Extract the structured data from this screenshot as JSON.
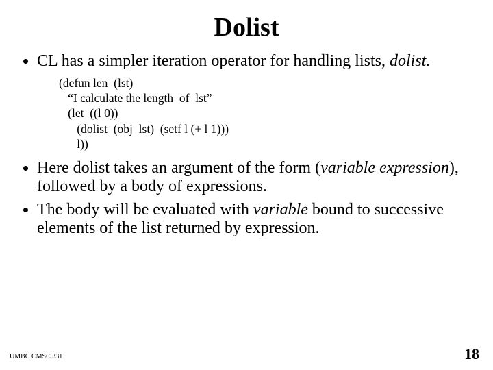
{
  "title": "Dolist",
  "bullets": {
    "b1_a": "CL has a simpler iteration operator for handling lists, ",
    "b1_b": "dolist.",
    "b2_a": "Here dolist takes an argument of the form (",
    "b2_b": "variable expression",
    "b2_c": "), followed by a body of expressions.",
    "b3_a": "The body will be evaluated with ",
    "b3_b": "variable",
    "b3_c": "  bound to successive elements of the list returned by expression."
  },
  "code": {
    "l1": "(defun len  (lst)",
    "l2": "   “I calculate the length  of  lst”",
    "l3": "   (let  ((l 0))",
    "l4": "      (dolist  (obj  lst)  (setf l (+ l 1)))",
    "l5": "      l))"
  },
  "footer": {
    "left": "UMBC CMSC 331",
    "right": "18"
  }
}
